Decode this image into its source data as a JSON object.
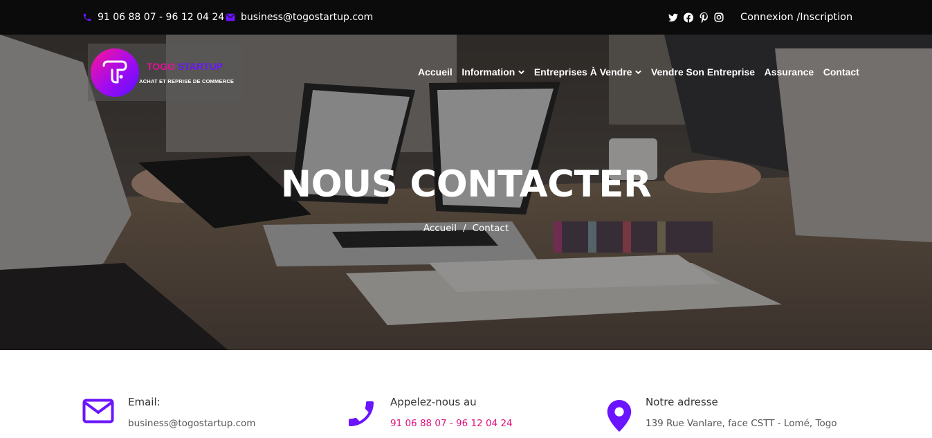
{
  "topbar": {
    "phone": "91 06 88 07 - 96 12 04 24",
    "email": "business@togostartup.com",
    "social_icons": [
      "twitter-icon",
      "facebook-icon",
      "pinterest-icon",
      "instagram-icon"
    ],
    "login_label": "Connexion /Inscription"
  },
  "logo": {
    "title_part1": "TOGO",
    "title_part2": "STARTUP",
    "subtitle": "ACHAT ET REPRISE DE COMMERCE"
  },
  "nav": {
    "items": [
      {
        "label": "Accueil",
        "has_dropdown": false
      },
      {
        "label": "Information",
        "has_dropdown": true
      },
      {
        "label": "Entreprises À Vendre",
        "has_dropdown": true
      },
      {
        "label": "Vendre Son Entreprise",
        "has_dropdown": false
      },
      {
        "label": "Assurance",
        "has_dropdown": false
      },
      {
        "label": "Contact",
        "has_dropdown": false
      }
    ]
  },
  "hero": {
    "title": "NOUS CONTACTER",
    "breadcrumb": {
      "home": "Accueil",
      "separator": "/",
      "current": "Contact"
    }
  },
  "contact": {
    "email_label": "Email:",
    "email_value": "business@togostartup.com",
    "phone_label": "Appelez-nous au",
    "phone_value": "91 06 88 07 - 96 12 04 24",
    "address_label": "Notre adresse",
    "address_value": "139 Rue Vanlare, face CSTT - Lomé, Togo"
  },
  "colors": {
    "accent_purple": "#6a14ff",
    "accent_pink": "#e0107a",
    "topbar_bg": "#0b0b0b"
  }
}
